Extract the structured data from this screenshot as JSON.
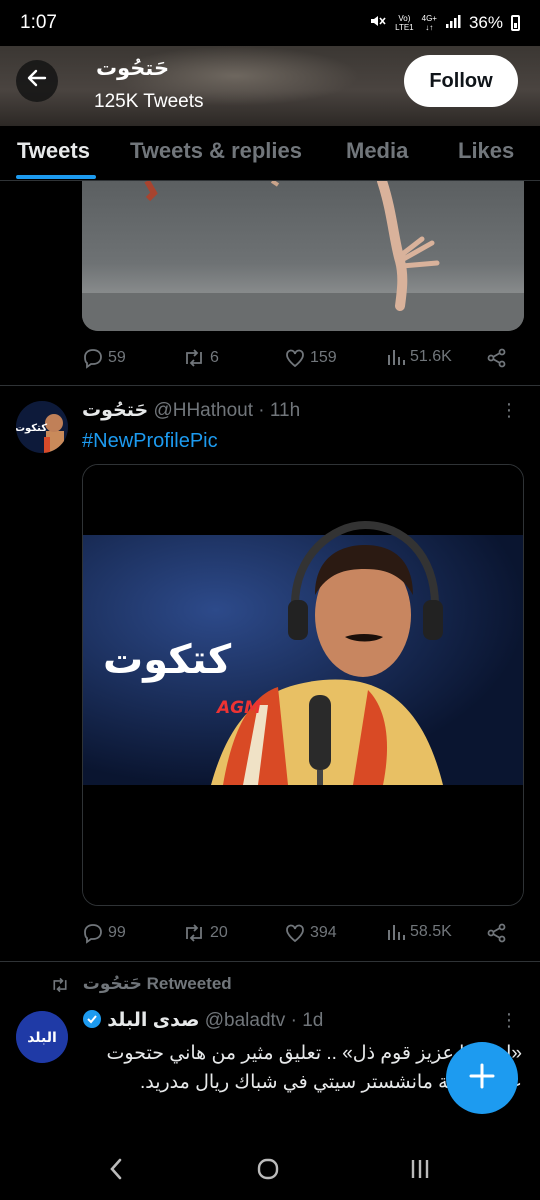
{
  "status_bar": {
    "time": "1:07",
    "volte_top": "Vo)",
    "volte_bottom": "LTE1",
    "net_top": "4G+",
    "net_bottom": "↓↑",
    "battery": "36%"
  },
  "header": {
    "name": "حَتحُوت",
    "tweet_count": "125K Tweets",
    "follow_label": "Follow"
  },
  "tabs": [
    {
      "label": "Tweets"
    },
    {
      "label": "Tweets & replies"
    },
    {
      "label": "Media"
    },
    {
      "label": "Likes"
    }
  ],
  "tweet1": {
    "replies": "59",
    "retweets": "6",
    "likes": "159",
    "views": "51.6K"
  },
  "tweet2": {
    "name": "حَتحُوت",
    "handle": "@HHathout",
    "time": "11h",
    "text": "#NewProfilePic",
    "avatar_text": "كتكوت",
    "media_title": "كتكوت",
    "media_logo": "AGM",
    "replies": "99",
    "retweets": "20",
    "likes": "394",
    "views": "58.5K"
  },
  "retweet_label": "حَتحُوت Retweeted",
  "tweet3": {
    "name": "صدى البلد",
    "handle": "@baladtv",
    "time": "1d",
    "avatar_text": "البلد",
    "text_line1": "«ارحموا عزيز قوم ذل» .. تعليق مثير من هاني حتحوت",
    "text_line2": "على صفعة مانشستر سيتي في شباك ريال مدريد."
  },
  "colors": {
    "accent": "#1d9bf0",
    "background": "#000000",
    "text": "#e7e9ea",
    "muted": "#71767b"
  }
}
